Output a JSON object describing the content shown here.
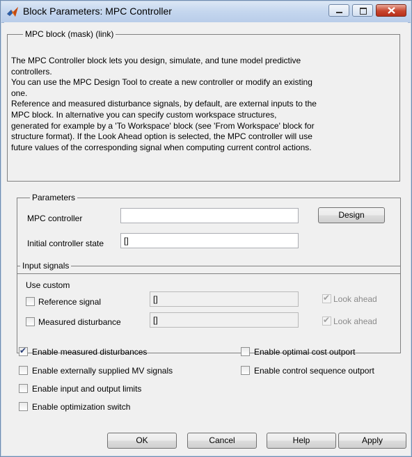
{
  "window": {
    "title": "Block Parameters: MPC Controller",
    "icon": "matlab-icon"
  },
  "mask": {
    "legend": "MPC block (mask) (link)",
    "description": [
      "The MPC Controller block lets you design, simulate, and tune model predictive",
      "controllers.",
      "You can use the MPC Design Tool to create a new controller or modify an existing",
      "one.",
      "Reference and measured disturbance signals, by default, are external inputs to the",
      "MPC block. In alternative you can specify custom workspace structures,",
      "generated for example by a 'To Workspace' block (see 'From Workspace' block for",
      "structure format). If the Look Ahead option is selected, the MPC controller will use",
      "future values of the corresponding signal when computing current control actions."
    ]
  },
  "parameters": {
    "legend": "Parameters",
    "mpc_controller_label": "MPC controller",
    "mpc_controller_value": "",
    "design_label": "Design",
    "initial_state_label": "Initial controller state",
    "initial_state_value": "[]"
  },
  "input_signals": {
    "legend": "Input signals",
    "use_custom_label": "Use custom",
    "reference": {
      "label": "Reference signal",
      "checked": false,
      "value": "[]",
      "look_ahead_label": "Look ahead",
      "look_ahead_checked": true
    },
    "measured": {
      "label": "Measured disturbance",
      "checked": false,
      "value": "[]",
      "look_ahead_label": "Look ahead",
      "look_ahead_checked": true
    }
  },
  "options": {
    "enable_md": {
      "label": "Enable measured disturbances",
      "checked": true
    },
    "enable_mv": {
      "label": "Enable externally supplied MV signals",
      "checked": false
    },
    "enable_limits": {
      "label": "Enable input and output limits",
      "checked": false
    },
    "enable_switch": {
      "label": "Enable optimization switch",
      "checked": false
    },
    "enable_cost": {
      "label": "Enable optimal cost outport",
      "checked": false
    },
    "enable_sequence": {
      "label": "Enable control sequence outport",
      "checked": false
    }
  },
  "footer": {
    "ok": "OK",
    "cancel": "Cancel",
    "help": "Help",
    "apply": "Apply"
  }
}
